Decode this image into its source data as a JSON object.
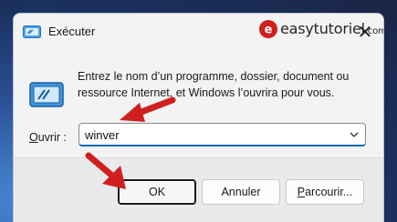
{
  "window": {
    "title": "Exécuter",
    "close_glyph": "✕"
  },
  "watermark": {
    "brand": "easytutoriel",
    "brand_suffix": ".com"
  },
  "content": {
    "description": "Entrez le nom d’un programme, dossier, document ou ressource Internet, et Windows l’ouvrira pour vous.",
    "open_label_accel": "O",
    "open_label_rest": "uvrir :",
    "open_value": "winver"
  },
  "buttons": {
    "ok": "OK",
    "cancel": "Annuler",
    "browse_accel": "P",
    "browse_rest": "arcourir..."
  },
  "colors": {
    "accent": "#0067c0",
    "annotation_arrow": "#d01f1f",
    "dialog_bg": "#f3f3f3",
    "footer_bg": "#e9eaec"
  },
  "icons": [
    "run-app-icon",
    "run-dialog-icon",
    "close-icon",
    "chevron-down-icon",
    "easytutoriel-logo-icon",
    "red-arrow-annotation"
  ]
}
